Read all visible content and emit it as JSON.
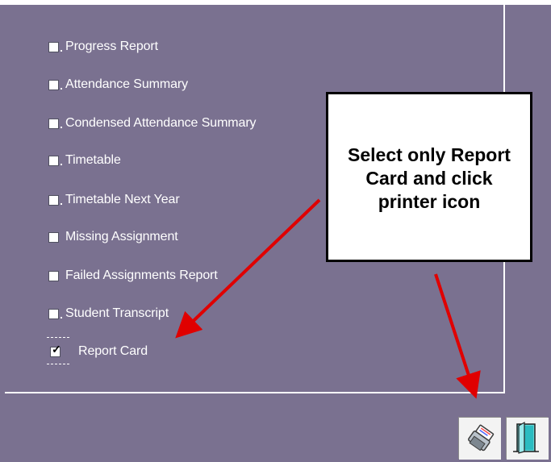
{
  "report_options": [
    {
      "label": "Progress Report",
      "checked": false
    },
    {
      "label": "Attendance Summary",
      "checked": false
    },
    {
      "label": "Condensed Attendance Summary",
      "checked": false
    },
    {
      "label": "Timetable",
      "checked": false
    },
    {
      "label": "Timetable Next Year",
      "checked": false
    },
    {
      "label": "Missing Assignment",
      "checked": false
    },
    {
      "label": "Failed Assignments Report",
      "checked": false
    },
    {
      "label": "Student Transcript",
      "checked": false
    },
    {
      "label": "Report Card",
      "checked": true
    }
  ],
  "callout": {
    "text": "Select only Report Card and click printer icon"
  },
  "buttons": {
    "printer": {
      "icon": "printer-icon"
    },
    "exit": {
      "icon": "door-icon"
    }
  },
  "colors": {
    "background": "#7a7190",
    "callout_bg": "#ffffff",
    "callout_border": "#000000",
    "arrow": "#e00000"
  }
}
